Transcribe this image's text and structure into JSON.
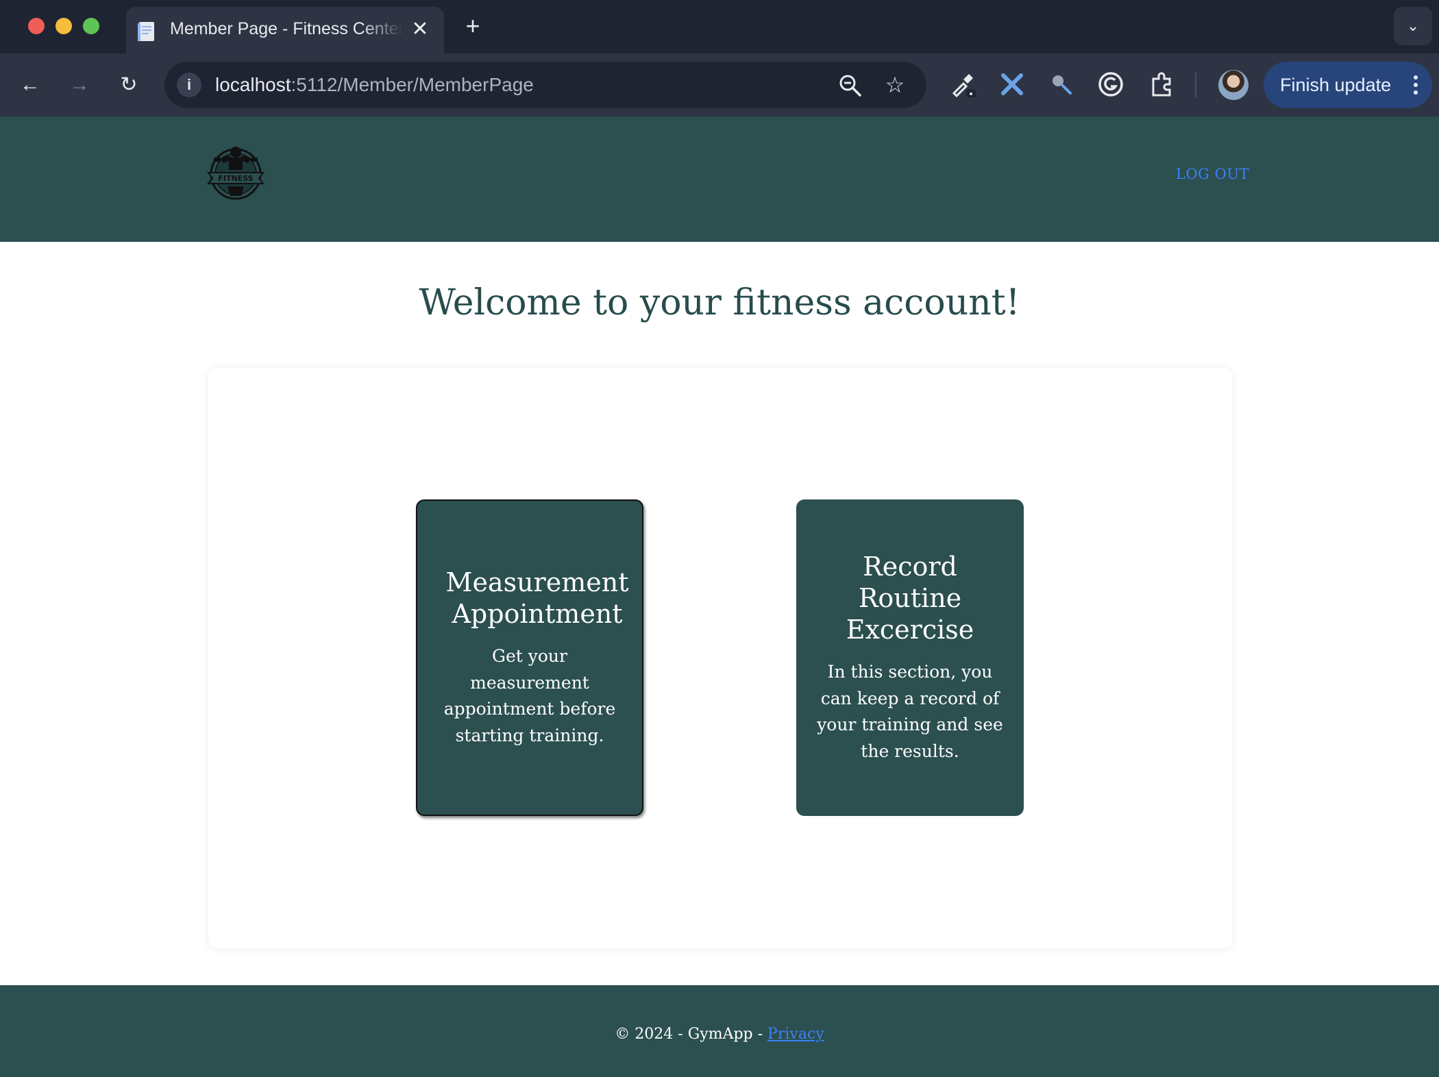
{
  "browser": {
    "tab_title": "Member Page - Fitness Center",
    "url_host": "localhost",
    "url_rest": ":5112/Member/MemberPage",
    "finish_update_label": "Finish update"
  },
  "header": {
    "logo_text": "FITNESS",
    "logout_label": "LOG OUT"
  },
  "main": {
    "welcome_title": "Welcome to your fitness account!",
    "cards": [
      {
        "title": "Measurement Appointment",
        "description": "Get your measurement appointment before starting training."
      },
      {
        "title": "Record Routine Excercise",
        "description": "In this section, you can keep a record of your training and see the results."
      }
    ]
  },
  "footer": {
    "copyright": "© 2024 - GymApp - ",
    "privacy_label": "Privacy"
  },
  "colors": {
    "brand_green": "#2c4f50",
    "link_blue": "#3b82f6",
    "chrome_dark": "#1f2433"
  }
}
